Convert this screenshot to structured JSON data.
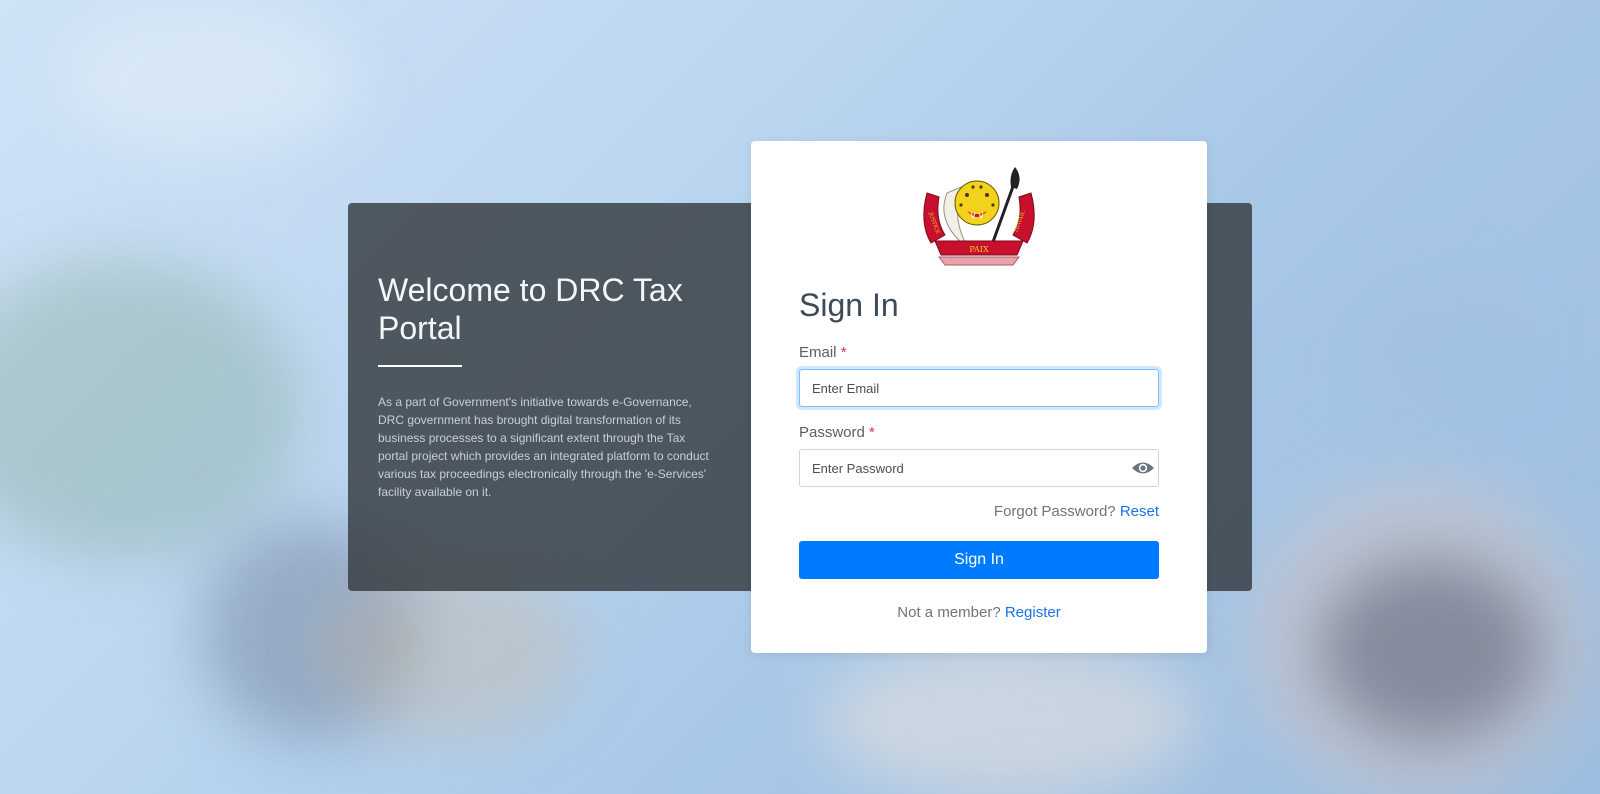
{
  "welcome": {
    "title": "Welcome to DRC Tax Portal",
    "description": "As a part of Government's initiative towards e-Governance, DRC government has brought digital transformation of its business processes to a significant extent through the Tax portal project which provides an integrated platform to conduct various tax proceedings electronically through the 'e-Services' facility available on it."
  },
  "emblem": {
    "icon": "coat-of-arms-icon",
    "motto_left": "JUSTICE",
    "motto_bottom": "PAIX",
    "motto_right": "TRAVAIL"
  },
  "login": {
    "title": "Sign In",
    "email_label": "Email",
    "email_placeholder": "Enter Email",
    "email_value": "",
    "password_label": "Password",
    "password_placeholder": "Enter Password",
    "password_value": "",
    "required_marker": "*",
    "forgot_text": "Forgot Password?",
    "reset_link": "Reset",
    "signin_button": "Sign In",
    "not_member_text": "Not a member?",
    "register_link": "Register"
  },
  "colors": {
    "primary": "#007bff",
    "link": "#1a73e8",
    "required": "#dc3545",
    "panel": "#343a40"
  }
}
